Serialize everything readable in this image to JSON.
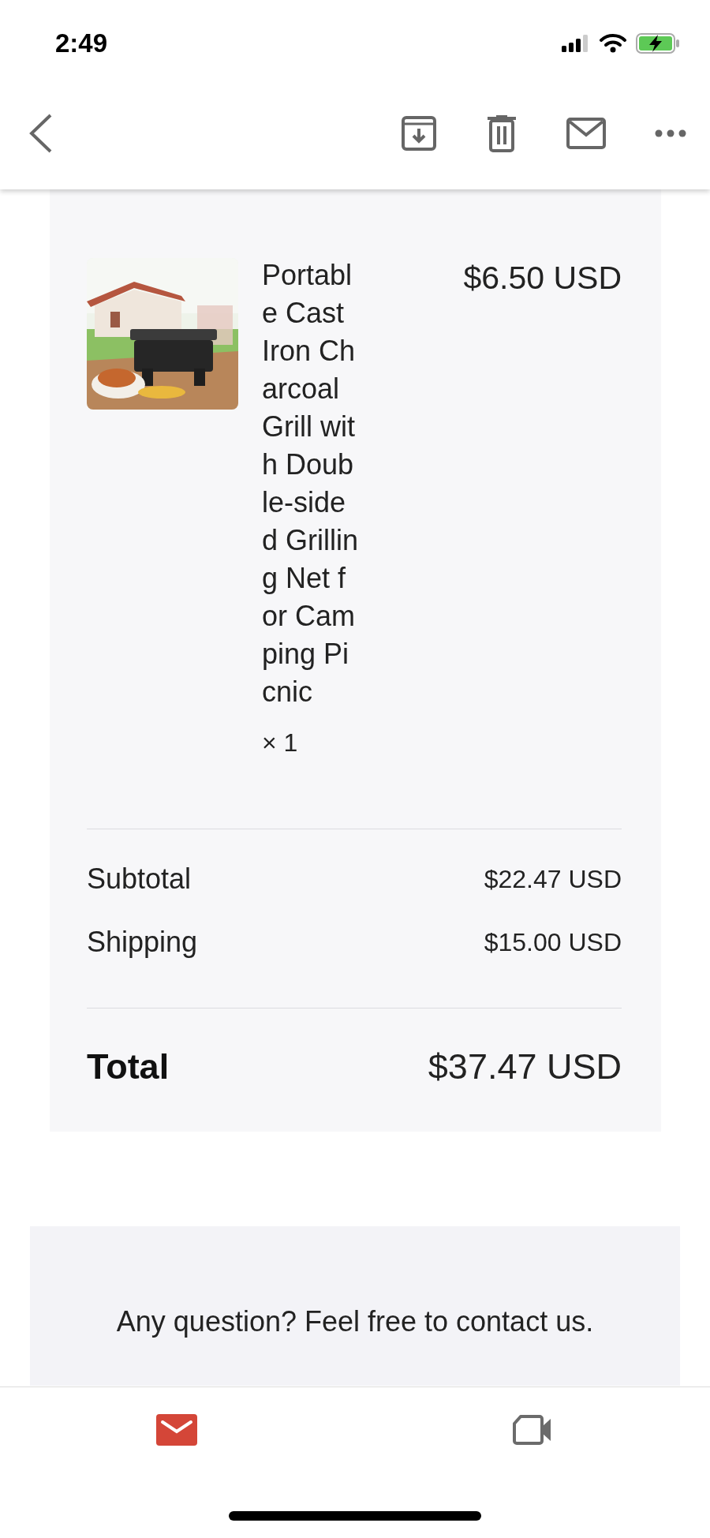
{
  "status_bar": {
    "time": "2:49"
  },
  "order": {
    "item": {
      "name": "Portable Cast Iron Charcoal Grill with Double-sided Grilling Net for Camping Picnic",
      "quantity": "× 1",
      "price": "$6.50 USD"
    },
    "summary": [
      {
        "label": "Subtotal",
        "value": "$22.47 USD"
      },
      {
        "label": "Shipping",
        "value": "$15.00 USD"
      }
    ],
    "total": {
      "label": "Total",
      "value": "$37.47 USD"
    }
  },
  "contact": {
    "text": "Any question? Feel free to contact us."
  },
  "bottom_nav": [
    {
      "kind": "mail",
      "selected": true
    },
    {
      "kind": "video",
      "selected": false
    }
  ]
}
